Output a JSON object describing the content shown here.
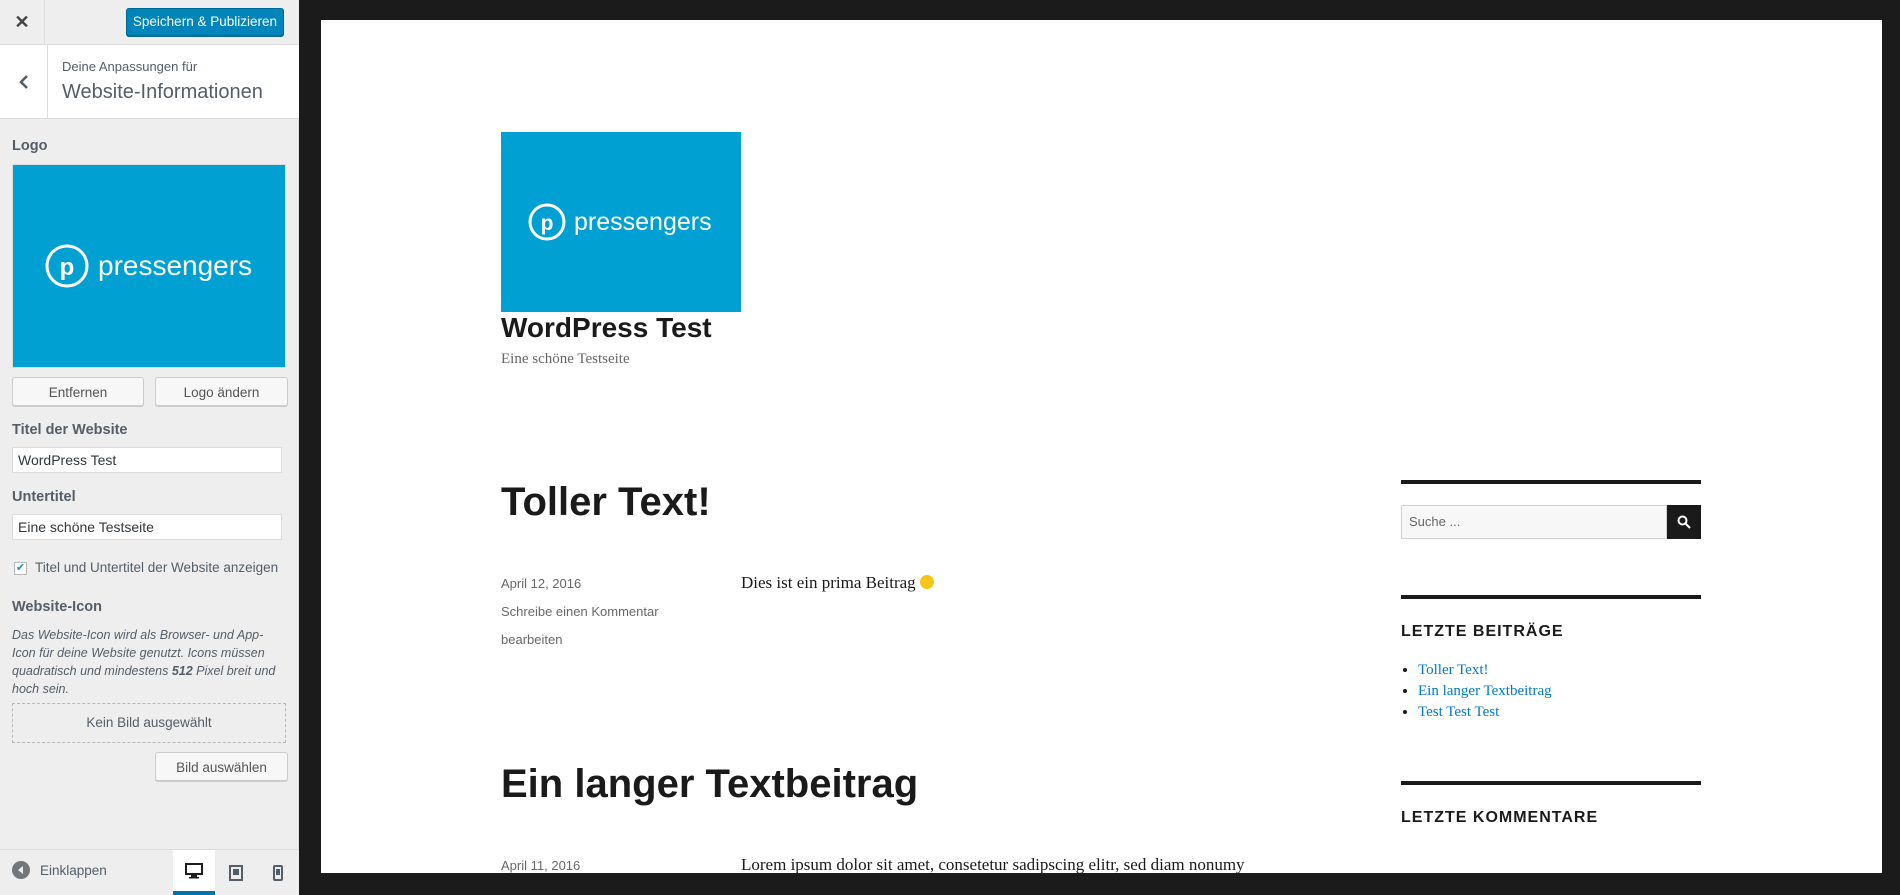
{
  "sidebar": {
    "close_icon": "close-icon",
    "publish_label": "Speichern & Publizieren",
    "section": {
      "pre_title": "Deine Anpassungen für",
      "title": "Website-Informationen"
    },
    "logo": {
      "label": "Logo",
      "logo_text": "pressengers",
      "remove_label": "Entfernen",
      "change_label": "Logo ändern"
    },
    "site_title": {
      "label": "Titel der Website",
      "value": "WordPress Test"
    },
    "tagline": {
      "label": "Untertitel",
      "value": "Eine schöne Testseite"
    },
    "display_header": {
      "label": "Titel und Untertitel der Website anzeigen",
      "checked": true
    },
    "site_icon": {
      "label": "Website-Icon",
      "desc_before": "Das Website-Icon wird als Browser- und App-Icon für deine Website genutzt. Icons müssen quadratisch und mindestens ",
      "desc_size": "512",
      "desc_after": " Pixel breit und hoch sein.",
      "placeholder": "Kein Bild ausgewählt",
      "select_label": "Bild auswählen"
    },
    "footer": {
      "collapse_label": "Einklappen",
      "devices": [
        "desktop-icon",
        "tablet-icon",
        "mobile-icon"
      ],
      "active_device": "desktop"
    }
  },
  "preview": {
    "logo_text": "pressengers",
    "site_title": "WordPress Test",
    "site_description": "Eine schöne Testseite",
    "posts": [
      {
        "title": "Toller Text!",
        "date": "April 12, 2016",
        "comment_link": "Schreibe einen Kommentar",
        "edit_link": "bearbeiten",
        "excerpt": "Dies ist ein prima Beitrag"
      },
      {
        "title": "Ein langer Textbeitrag",
        "date": "April 11, 2016",
        "excerpt": "Lorem ipsum dolor sit amet, consetetur sadipscing elitr, sed diam nonumy"
      }
    ],
    "widgets": {
      "search_placeholder": "Suche ...",
      "recent_posts_title": "LETZTE BEITRÄGE",
      "recent_posts": [
        "Toller Text!",
        "Ein langer Textbeitrag",
        "Test Test Test"
      ],
      "recent_comments_title": "LETZTE KOMMENTARE"
    }
  },
  "colors": {
    "accent": "#0085ba",
    "logo_bg": "#00a0d2",
    "link": "#007acc",
    "frame_bg": "#1b1b1b"
  }
}
